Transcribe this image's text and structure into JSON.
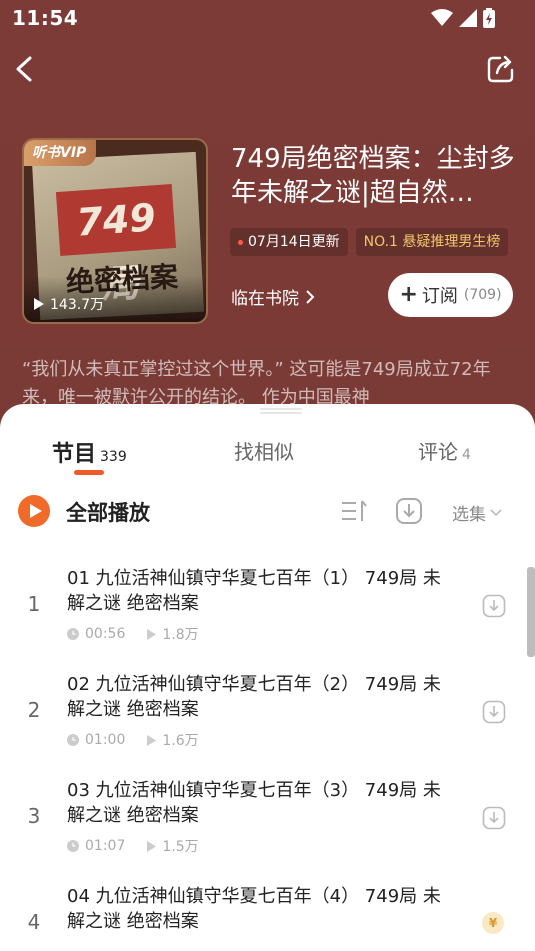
{
  "status_bar": {
    "time": "11:54"
  },
  "header": {
    "back_icon": "chevron-left-icon",
    "share_icon": "share-icon"
  },
  "book": {
    "cover_badge": "听书VIP",
    "cover_stamp": "749局",
    "cover_title": "绝密档案",
    "cover_plays": "143.7万",
    "title": "749局绝密档案：尘封多年未解之谜|超自然…",
    "update_tag": "07月14日更新",
    "rank_tag": "NO.1 悬疑推理男生榜",
    "author": "临在书院",
    "subscribe_label": "订阅",
    "subscribe_count": "(709)",
    "intro": "“我们从未真正掌控过这个世界。” 这可能是749局成立72年来，唯一被默许公开的结论。 作为中国最神"
  },
  "tabs": [
    {
      "label": "节目",
      "count": "339",
      "active": true
    },
    {
      "label": "找相似",
      "count": ""
    },
    {
      "label": "评论",
      "count": "4"
    }
  ],
  "toolbar": {
    "play_all": "全部播放",
    "select_episodes": "选集"
  },
  "episodes": [
    {
      "index": "1",
      "title": "01 九位活神仙镇守华夏七百年（1） 749局 未解之谜 绝密档案",
      "duration": "00:56",
      "plays": "1.8万",
      "action": "download"
    },
    {
      "index": "2",
      "title": "02 九位活神仙镇守华夏七百年（2） 749局 未解之谜 绝密档案",
      "duration": "01:00",
      "plays": "1.6万",
      "action": "download"
    },
    {
      "index": "3",
      "title": "03 九位活神仙镇守华夏七百年（3） 749局 未解之谜 绝密档案",
      "duration": "01:07",
      "plays": "1.5万",
      "action": "download"
    },
    {
      "index": "4",
      "title": "04 九位活神仙镇守华夏七百年（4） 749局 未解之谜 绝密档案",
      "duration": "",
      "plays": "",
      "action": "pay"
    }
  ],
  "colors": {
    "header_bg": "#7a3a35",
    "accent": "#f06a2a",
    "rank": "#f2c66a"
  }
}
